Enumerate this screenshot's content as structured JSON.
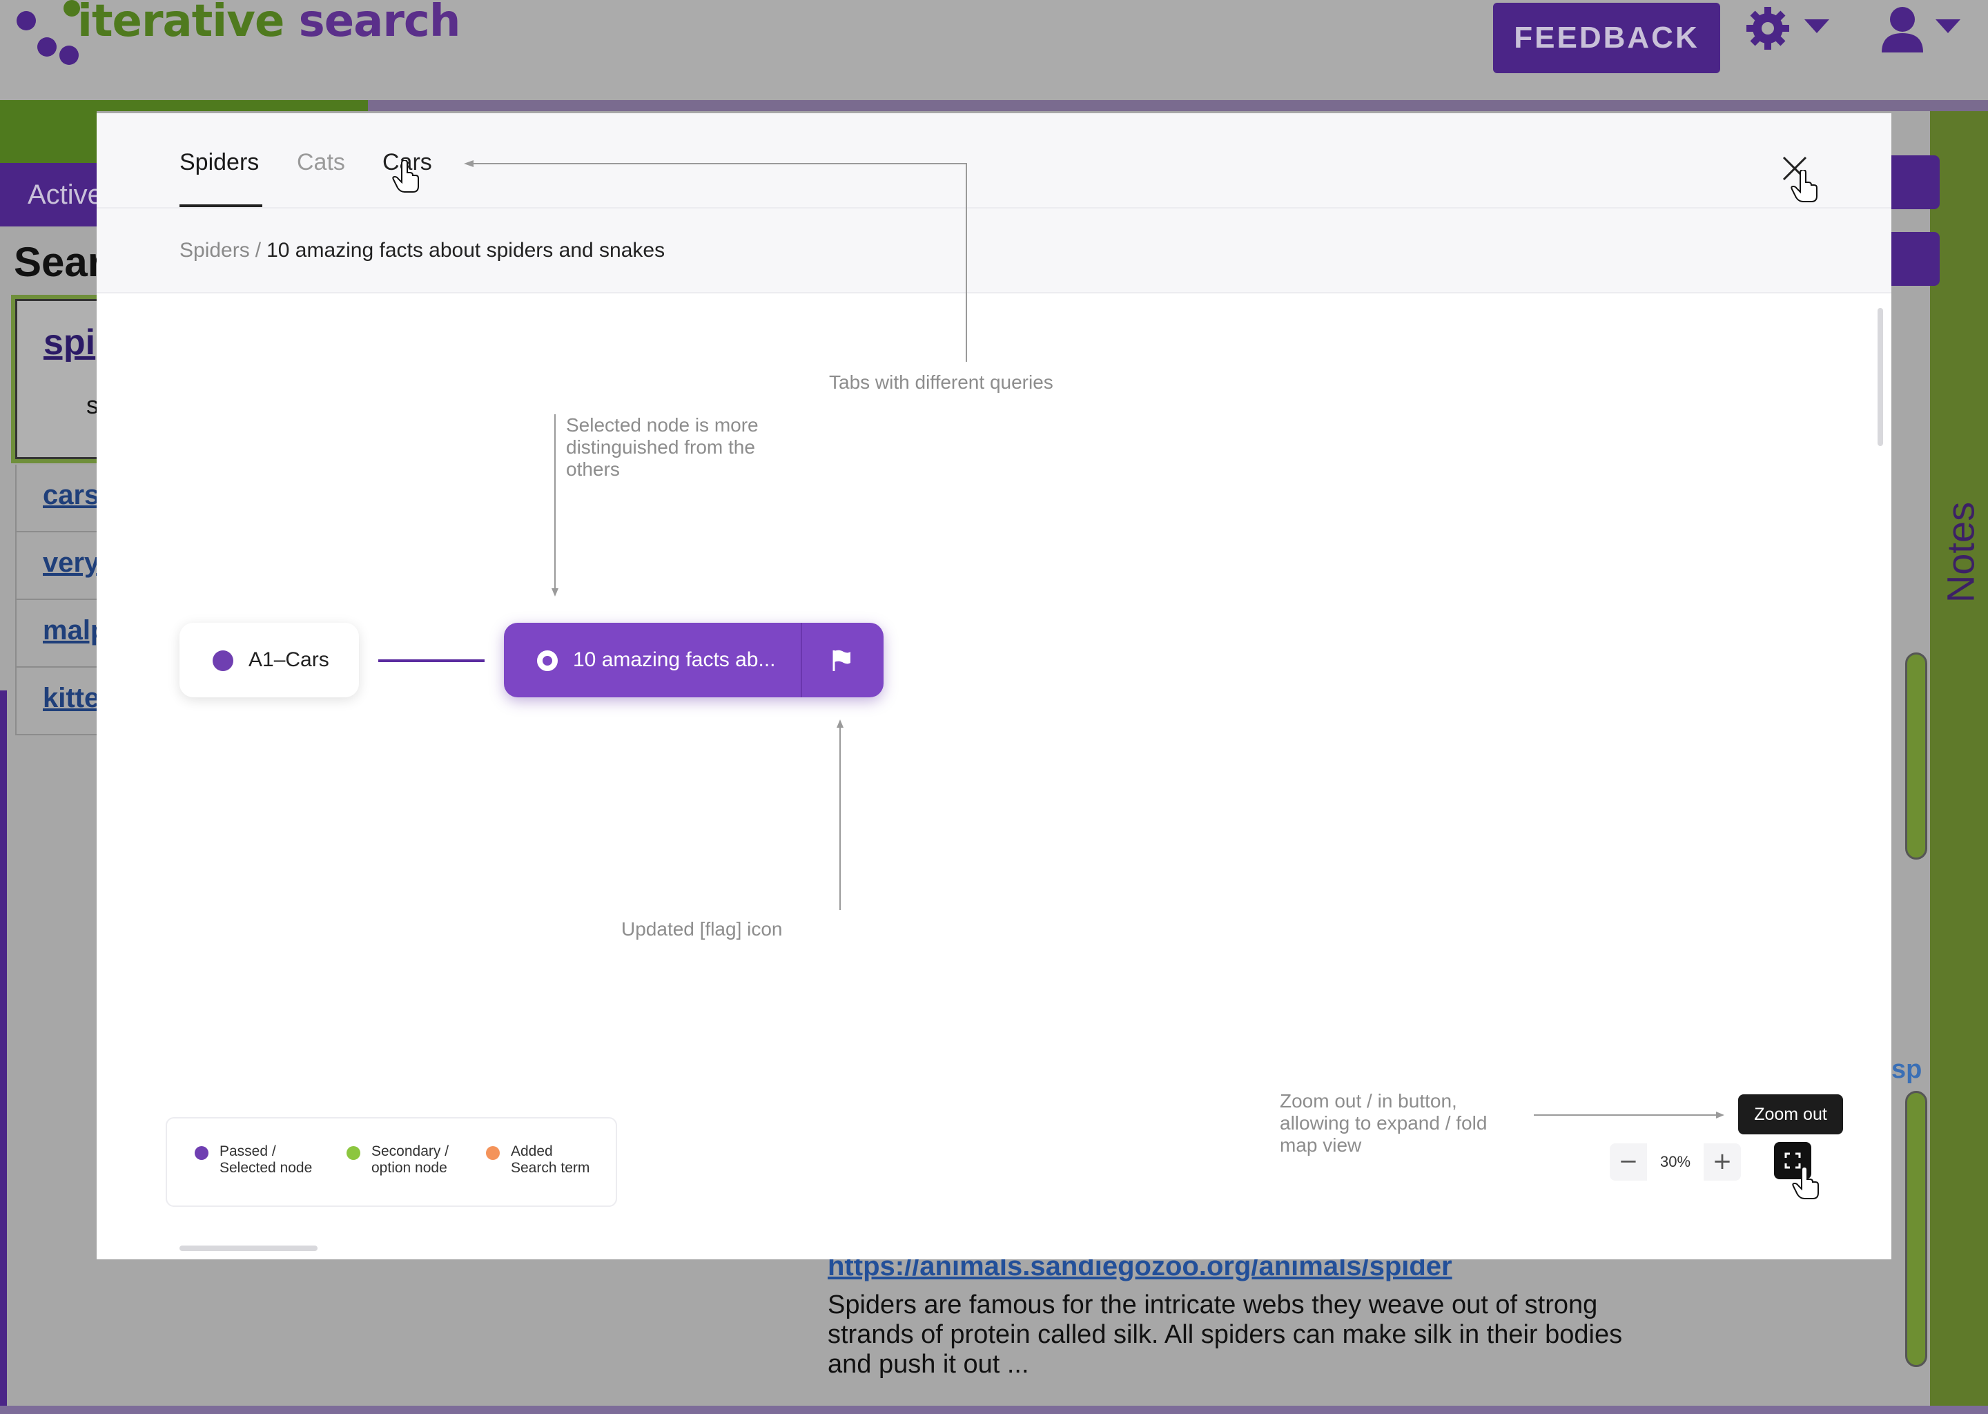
{
  "app": {
    "logo_part1": "iterative",
    "logo_part2": " search",
    "feedback_label": "FEEDBACK",
    "progress_fraction": 0.185
  },
  "background": {
    "active_tab_label": "Active",
    "search_heading": "Sear",
    "card_link": "spi",
    "card_sub": "s",
    "list_items": [
      "cars",
      "very",
      "malp",
      "kitte"
    ],
    "notes_label": "Notes",
    "partial_link": "sp",
    "result": {
      "url": "https://animals.sandiegozoo.org/animals/spider",
      "snippet": "Spiders are famous for the intricate webs they weave out of strong strands of protein called silk. All spiders can make silk in their bodies and push it out ..."
    }
  },
  "modal": {
    "tabs": [
      {
        "label": "Spiders",
        "state": "active"
      },
      {
        "label": "Cats",
        "state": "inactive"
      },
      {
        "label": "Cars",
        "state": "hover"
      }
    ],
    "breadcrumb": {
      "root": "Spiders",
      "separator": "/",
      "current": "10 amazing facts about spiders and snakes"
    },
    "nodes": [
      {
        "label": "A1–Cars",
        "type": "passed"
      },
      {
        "label": "10 amazing facts ab...",
        "type": "selected",
        "icon": "flag-icon"
      }
    ],
    "annotations": {
      "tabs": "Tabs with different queries",
      "selected_line1": "Selected node is more",
      "selected_line2": "distinguished from the",
      "selected_line3": "others",
      "flag": "Updated [flag] icon",
      "zoom_line1": "Zoom out / in button,",
      "zoom_line2": "allowing to expand / fold",
      "zoom_line3": "map view"
    },
    "legend": [
      {
        "line1": "Passed /",
        "line2": "Selected node",
        "color": "#6f3fb1"
      },
      {
        "line1": "Secondary /",
        "line2": "option node",
        "color": "#8cc63f"
      },
      {
        "line1": "Added",
        "line2": "Search term",
        "color": "#f4935a"
      }
    ],
    "zoom": {
      "minus": "−",
      "value": "30%",
      "plus": "+",
      "tooltip": "Zoom out"
    }
  },
  "colors": {
    "accent_purple": "#7d46c5",
    "brand_green": "#4f7a1e",
    "brand_purple": "#4b2587"
  }
}
